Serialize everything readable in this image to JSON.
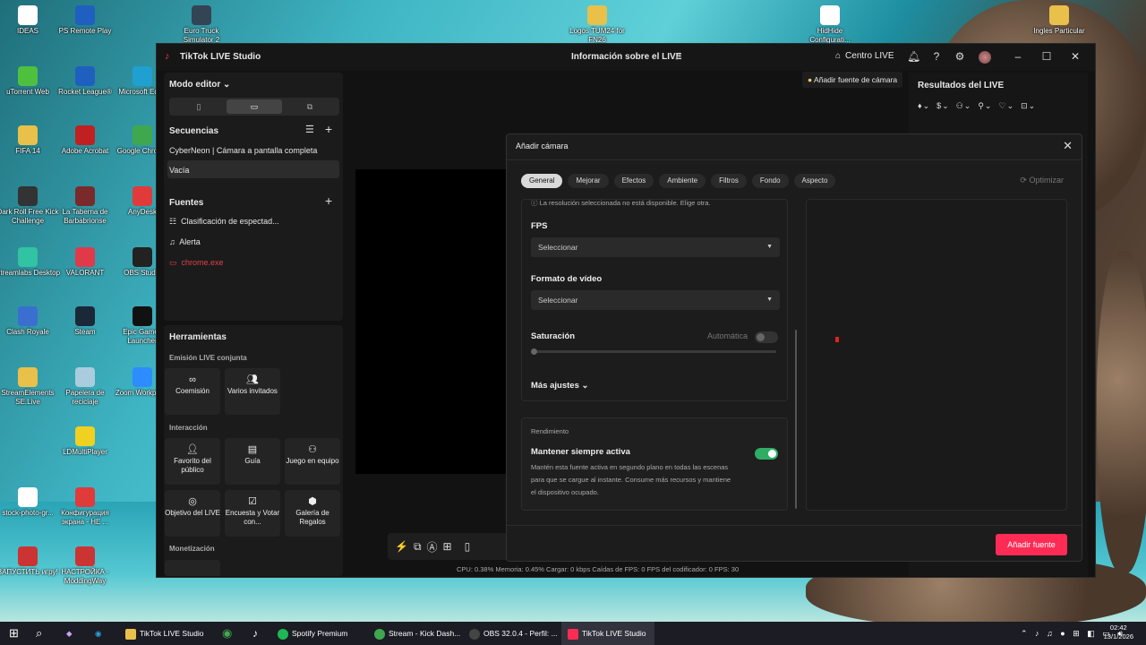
{
  "desktop_icons": [
    {
      "label": "IDEAS",
      "color": "#ffffff"
    },
    {
      "label": "PS Remote Play",
      "color": "#1f5fbf"
    },
    {
      "label": "Euro Truck Simulator 2",
      "color": "#334455"
    },
    {
      "label": "Logos TUM24 for FN26",
      "color": "#e8c04a"
    },
    {
      "label": "HidHide Configurati...",
      "color": "#ffffff"
    },
    {
      "label": "Ingles Particular",
      "color": "#e8c04a"
    },
    {
      "label": "uTorrent Web",
      "color": "#4fbf3f"
    },
    {
      "label": "Rocket League®",
      "color": "#1f5fbf"
    },
    {
      "label": "Microsoft Edge",
      "color": "#1fa0d0"
    },
    {
      "label": "FIFA 14",
      "color": "#e8c04a"
    },
    {
      "label": "Adobe Acrobat",
      "color": "#c0201f"
    },
    {
      "label": "Google Chrome",
      "color": "#3fa84f"
    },
    {
      "label": "Dark Roll Free Kick Challenge",
      "color": "#333333"
    },
    {
      "label": "La Taberna de Barbabrionse",
      "color": "#7a2a2a"
    },
    {
      "label": "AnyDesk",
      "color": "#e03a3a"
    },
    {
      "label": "Streamlabs Desktop",
      "color": "#31c3a2"
    },
    {
      "label": "VALORANT",
      "color": "#e03a4a"
    },
    {
      "label": "OBS Studio",
      "color": "#222222"
    },
    {
      "label": "Clash Royale",
      "color": "#3a6fd0"
    },
    {
      "label": "Steam",
      "color": "#1b2838"
    },
    {
      "label": "Epic Games Launcher",
      "color": "#111111"
    },
    {
      "label": "StreamElements SE.Live",
      "color": "#e8c04a"
    },
    {
      "label": "Papelera de reciclaje",
      "color": "#aaccdd"
    },
    {
      "label": "Zoom Workplace",
      "color": "#2d8cff"
    },
    {
      "label": "LDMultiPlayer",
      "color": "#f0d020"
    },
    {
      "label": "stock-photo-gr...",
      "color": "#ffffff"
    },
    {
      "label": "Конфигурация экрана - НЕ ...",
      "color": "#e03a3a"
    },
    {
      "label": "ЗАПУСТИТЬ игру!",
      "color": "#cc3333"
    },
    {
      "label": "НАСТРОЙКА - ModdingWay",
      "color": "#cc3333"
    }
  ],
  "window": {
    "app_title": "TikTok LIVE Studio",
    "center_title": "Información sobre el LIVE",
    "live_center": "Centro LIVE",
    "window_controls": [
      "minimize-icon",
      "maximize-icon",
      "close-icon"
    ]
  },
  "left": {
    "mode": "Modo editor",
    "sequences_title": "Secuencias",
    "sequences": [
      "CyberNeon | Cámara a pantalla completa",
      "Vacía"
    ],
    "sources_title": "Fuentes",
    "sources": [
      {
        "label": "Clasificación de espectad...",
        "icon": "list-icon"
      },
      {
        "label": "Alerta",
        "icon": "bell-icon"
      },
      {
        "label": "chrome.exe",
        "icon": "window-icon",
        "color": "#e0404a"
      }
    ],
    "tools_title": "Herramientas",
    "group_collab": "Emisión LIVE conjunta",
    "collab_tools": [
      "Coemisión",
      "Varios invitados"
    ],
    "group_interaction": "Interacción",
    "interaction_tools": [
      "Favorito del público",
      "Guía",
      "Juego en equipo",
      "Objetivo del LIVE",
      "Encuesta y Votar con...",
      "Galería de Regalos"
    ],
    "group_monetization": "Monetización"
  },
  "center": {
    "add_camera_chip": "Añadir fuente de cámara",
    "stats": "CPU: 0.38%    Memoria: 0.45%    Cargar: 0 kbps    Caídas de FPS: 0    FPS del codificador: 0    FPS: 30"
  },
  "right": {
    "title": "Resultados del LIVE"
  },
  "modal": {
    "title": "Añadir cámara",
    "tabs": [
      "General",
      "Mejorar",
      "Efectos",
      "Ambiente",
      "Filtros",
      "Fondo",
      "Aspecto"
    ],
    "active_tab": "General",
    "optimize": "Optimizar",
    "warning": "La resolución seleccionada no está disponible. Elige otra.",
    "fps_label": "FPS",
    "fps_value": "Seleccionar",
    "video_format_label": "Formato de vídeo",
    "video_format_value": "Seleccionar",
    "saturation_label": "Saturación",
    "saturation_auto": "Automática",
    "saturation_auto_on": false,
    "saturation_value": 0,
    "more_settings": "Más ajustes",
    "performance_header": "Rendimiento",
    "keep_active_label": "Mantener siempre activa",
    "keep_active_on": true,
    "keep_active_desc": "Mantén esta fuente activa en segundo plano en todas las escenas para que se cargue al instante. Consume más recursos y mantiene el dispositivo ocupado.",
    "add_button": "Añadir fuente"
  },
  "taskbar": {
    "items": [
      {
        "label": "TikTok LIVE Studio",
        "color": "#e8c04a"
      },
      {
        "label": "Spotify Premium",
        "color": "#1db954"
      },
      {
        "label": "Stream - Kick Dash...",
        "color": "#3fa84f"
      },
      {
        "label": "OBS 32.0.4 - Perfil: ...",
        "color": "#222222"
      },
      {
        "label": "TikTok LIVE Studio",
        "color": "#fe2c55"
      }
    ],
    "time": "02:42",
    "date": "13/1/2026"
  }
}
